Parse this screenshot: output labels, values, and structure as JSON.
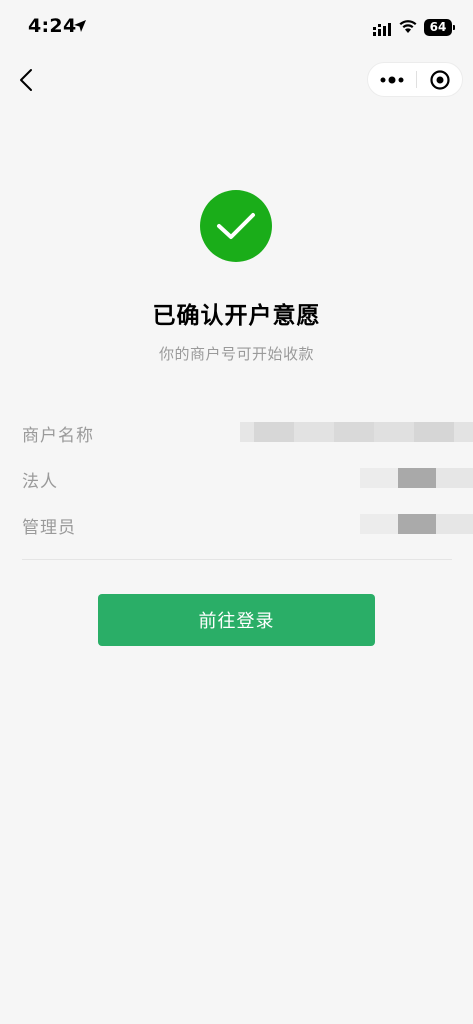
{
  "status_bar": {
    "time": "4:24",
    "battery": "64"
  },
  "page": {
    "title": "已确认开户意愿",
    "subtitle": "你的商户号可开始收款",
    "info": [
      {
        "label": "商户名称"
      },
      {
        "label": "法人"
      },
      {
        "label": "管理员"
      }
    ],
    "login_button": "前往登录"
  },
  "colors": {
    "success": "#1aad19",
    "button": "#2aae67",
    "background": "#f6f6f6"
  },
  "icons": [
    "location-arrow-icon",
    "signal-icon",
    "wifi-icon",
    "back-icon",
    "more-dots-icon",
    "close-target-icon",
    "checkmark-icon"
  ]
}
